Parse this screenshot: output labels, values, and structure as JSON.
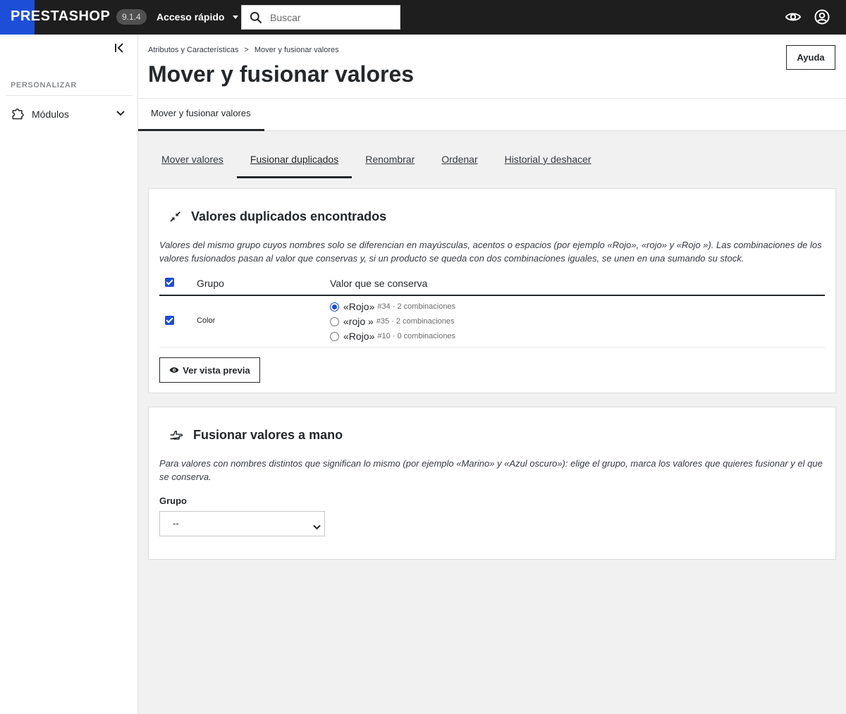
{
  "topbar": {
    "logo": "PRESTASHOP",
    "version": "9.1.4",
    "quick_access": "Acceso rápido",
    "search_placeholder": "Buscar"
  },
  "sidebar": {
    "section": "PERSONALIZAR",
    "items": [
      {
        "label": "Módulos"
      }
    ]
  },
  "header": {
    "breadcrumb": [
      "Atributos y Características",
      "Mover y fusionar valores"
    ],
    "breadcrumb_separator": ">",
    "title": "Mover y fusionar valores",
    "help_label": "Ayuda",
    "tab": "Mover y fusionar valores"
  },
  "tabs": [
    {
      "label": "Mover valores"
    },
    {
      "label": "Fusionar duplicados",
      "active": true
    },
    {
      "label": "Renombrar"
    },
    {
      "label": "Ordenar"
    },
    {
      "label": "Historial y deshacer"
    }
  ],
  "duplicates": {
    "title": "Valores duplicados encontrados",
    "description": "Valores del mismo grupo cuyos nombres solo se diferencian en mayúsculas, acentos o espacios (por ejemplo «Rojo», «rojo» y «Rojo »). Las combinaciones de los valores fusionados pasan al valor que conservas y, si un producto se queda con dos combinaciones iguales, se unen en una sumando su stock.",
    "columns": {
      "group": "Grupo",
      "keep": "Valor que se conserva"
    },
    "rows": [
      {
        "group": "Color",
        "checked": true,
        "options": [
          {
            "name": "«Rojo»",
            "meta": "#34 · 2 combinaciones",
            "selected": true
          },
          {
            "name": "«rojo »",
            "meta": "#35 · 2 combinaciones",
            "selected": false
          },
          {
            "name": "«Rojo»",
            "meta": "#10 · 0 combinaciones",
            "selected": false
          }
        ]
      }
    ],
    "preview_button": "Ver vista previa"
  },
  "manual": {
    "title": "Fusionar valores a mano",
    "description": "Para valores con nombres distintos que significan lo mismo (por ejemplo «Marino» y «Azul oscuro»): elige el grupo, marca los valores que quieres fusionar y el que se conserva.",
    "group_label": "Grupo",
    "group_value": "--"
  },
  "colors": {
    "accent": "#1d4ed8",
    "topbar": "#1e1e1e",
    "text": "#25282b"
  }
}
